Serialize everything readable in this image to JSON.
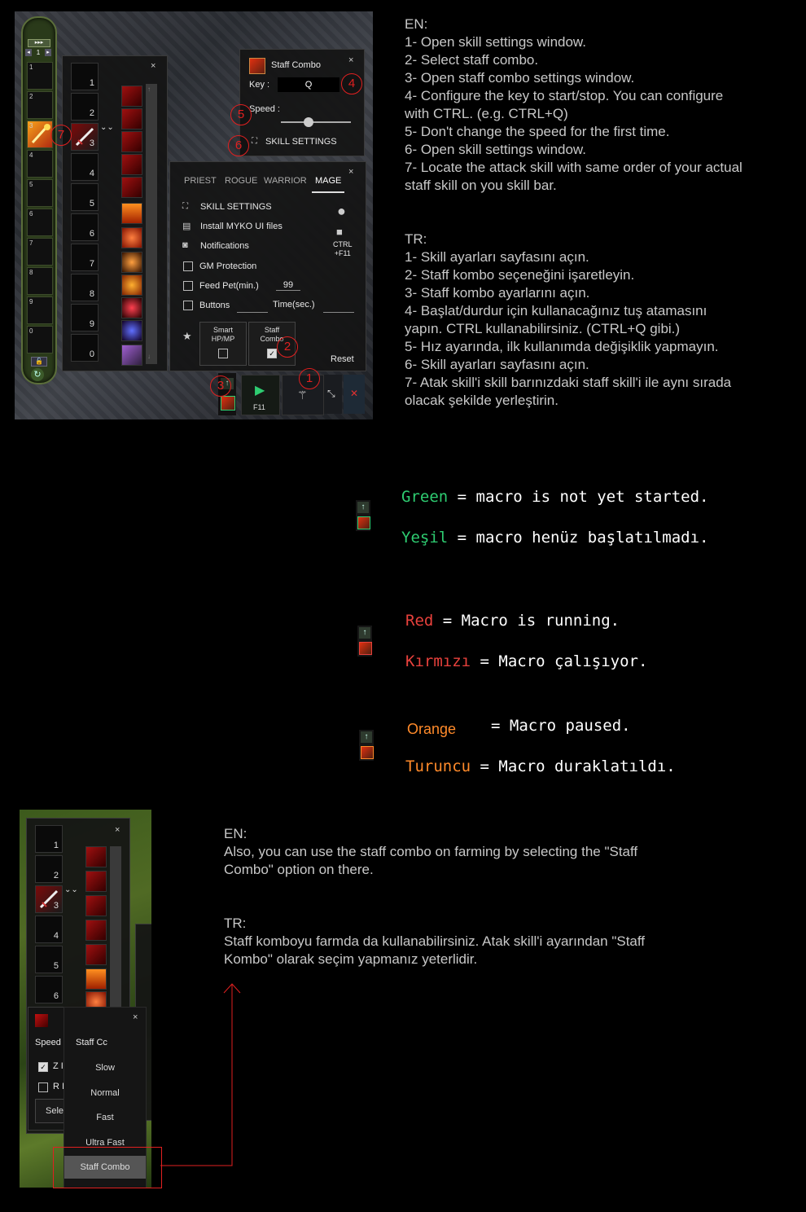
{
  "screenshot1": {
    "skillbar": {
      "page": "1",
      "slots": [
        "1",
        "2",
        "3",
        "4",
        "5",
        "6",
        "7",
        "8",
        "9",
        "0"
      ]
    },
    "skill_list_panel": {
      "close": "×",
      "slots": [
        "1",
        "2",
        "3",
        "4",
        "5",
        "6",
        "7",
        "8",
        "9",
        "0"
      ]
    },
    "staff_combo_panel": {
      "title": "Staff Combo",
      "close": "×",
      "key_label": "Key :",
      "key_value": "Q",
      "speed_label": "Speed :",
      "speed_level": 0.4,
      "skill_settings_label": "SKILL SETTINGS"
    },
    "settings_panel": {
      "close": "×",
      "tabs": [
        "PRIEST",
        "ROGUE",
        "WARRIOR",
        "MAGE"
      ],
      "active_tab": "MAGE",
      "skill_settings": "SKILL SETTINGS",
      "install_ui": "Install MYKO UI files",
      "notifications": "Notifications",
      "gm_protection": "GM Protection",
      "feed_pet": "Feed Pet(min.)",
      "feed_pet_value": "99",
      "buttons": "Buttons",
      "time_sec": "Time(sec.)",
      "ctrl_f11": "CTRL\n+F11",
      "smart_hp_mp": "Smart\nHP/MP",
      "staff_combo": "Staff\nCombo",
      "reset": "Reset"
    },
    "bottom_bar": {
      "f11": "F11"
    },
    "markers": [
      "1",
      "2",
      "3",
      "4",
      "5",
      "6",
      "7"
    ]
  },
  "instructions_en": {
    "header": "EN:",
    "lines": [
      "1- Open skill settings window.",
      "2- Select staff combo.",
      "3- Open staff combo settings window.",
      "4- Configure the key to start/stop. You can configure",
      "with CTRL. (e.g. CTRL+Q)",
      "5- Don't change the speed for the first time.",
      "6- Open skill settings window.",
      "7- Locate the attack skill with same order of your actual",
      "staff skill on you skill bar."
    ]
  },
  "instructions_tr": {
    "header": "TR:",
    "lines": [
      "1- Skill ayarları sayfasını açın.",
      "2- Staff kombo seçeneğini işaretleyin.",
      "3- Staff kombo ayarlarını açın.",
      "4- Başlat/durdur için kullanacağınız tuş atamasını",
      "yapın. CTRL kullanabilirsiniz. (CTRL+Q gibi.)",
      "5- Hız ayarında, ilk kullanımda değişiklik yapmayın.",
      "6- Skill ayarları sayfasını açın.",
      "7- Atak skill'i skill barınızdaki staff skill'i ile aynı sırada",
      "olacak şekilde yerleştirin."
    ]
  },
  "legend": {
    "green_en_word": "Green",
    "green_en_rest": " = macro is not yet started.",
    "green_tr_word": "Yeşil",
    "green_tr_rest": " = macro henüz başlatılmadı.",
    "red_en_word": "Red",
    "red_en_rest": " = Macro is running.",
    "red_tr_word": "Kırmızı",
    "red_tr_rest": " = Macro çalışıyor.",
    "orange_en_word": "Orange",
    "orange_en_rest": "= Macro paused.",
    "orange_tr_word": "Turuncu",
    "orange_tr_rest": " = Macro duraklatıldı.",
    "colors": {
      "green": "#2ecc71",
      "red": "#e8413c",
      "orange": "#ff8a2a"
    }
  },
  "screenshot2": {
    "close": "×",
    "slots": [
      "1",
      "2",
      "3",
      "4",
      "5",
      "6"
    ],
    "dropdown_close": "×",
    "speed_label": "Speed",
    "staff_cc": "Staff Cc",
    "check_z": "Z I",
    "check_r": "R I",
    "select": "Sele",
    "options": [
      "Slow",
      "Normal",
      "Fast",
      "Ultra Fast",
      "Staff Combo"
    ],
    "selected": "Staff Combo"
  },
  "farming_en": {
    "header": "EN:",
    "lines": [
      "Also, you can use the staff combo on farming by selecting the \"Staff",
      "Combo\" option on there."
    ]
  },
  "farming_tr": {
    "header": "TR:",
    "lines": [
      "Staff komboyu farmda da kullanabilirsiniz. Atak skill'i ayarından \"Staff",
      "Kombo\" olarak seçim yapmanız yeterlidir."
    ]
  }
}
